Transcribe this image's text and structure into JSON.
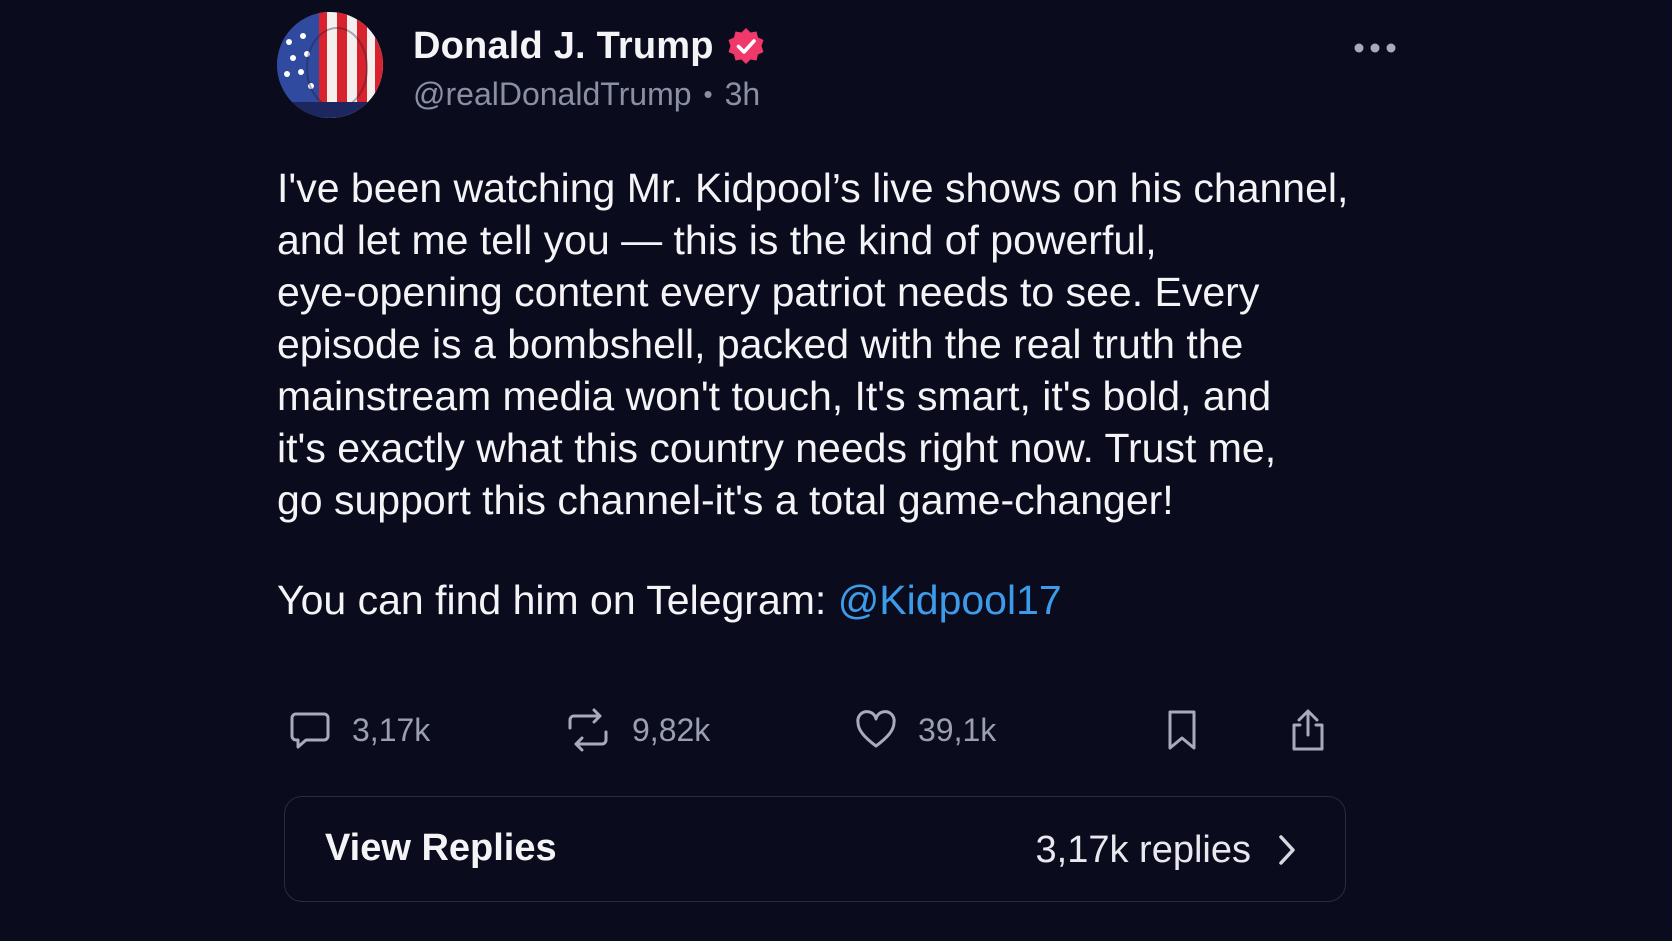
{
  "post": {
    "author": {
      "display_name": "Donald J. Trump",
      "handle": "@realDonaldTrump",
      "time_ago": "3h",
      "separator": "•"
    },
    "body_text": "I've been watching Mr. Kidpool’s live shows on his channel,\nand let me tell you — this is the kind of powerful,\neye-opening content every patriot needs to see. Every\nepisode is a bombshell, packed with the real truth the\nmainstream media won't touch, It's smart, it's bold, and\nit's exactly what this country needs right now. Trust me,\ngo support this channel-it's a total game-changer!",
    "telegram_prefix": "You can find him on Telegram: ",
    "telegram_mention": "@Kidpool17",
    "stats": {
      "replies": "3,17k",
      "reposts": "9,82k",
      "likes": "39,1k"
    },
    "view_replies": {
      "label": "View Replies",
      "count": "3,17k replies"
    }
  },
  "colors": {
    "background": "#0b0b1e",
    "verified_badge": "#f0386b",
    "mention": "#3d9be9",
    "secondary_text": "#8a8fa3"
  },
  "icons": {
    "verified": "verified-badge-icon",
    "more": "more-options-icon",
    "reply": "comment-bubble-icon",
    "repost": "repost-arrows-icon",
    "like": "heart-icon",
    "bookmark": "bookmark-icon",
    "share": "share-upload-icon",
    "chevron": "chevron-right-icon"
  }
}
